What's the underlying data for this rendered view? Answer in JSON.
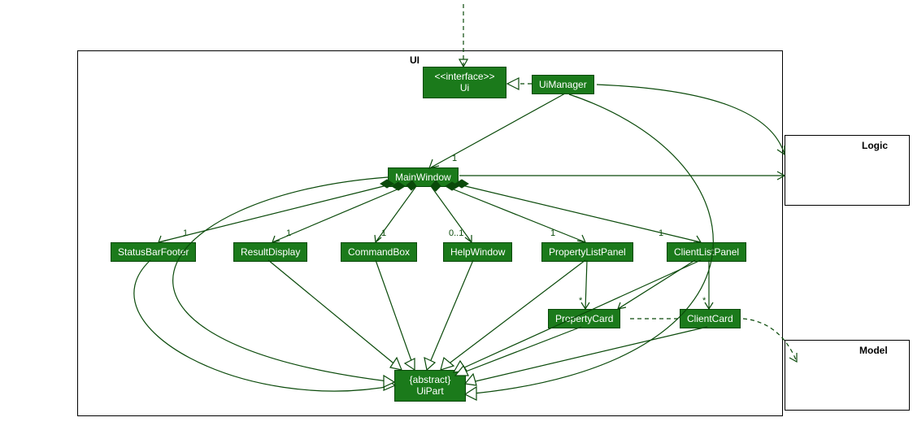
{
  "packages": {
    "ui": {
      "label": "UI"
    },
    "logic": {
      "label": "Logic"
    },
    "model": {
      "label": "Model"
    }
  },
  "classes": {
    "ui_interface": {
      "stereotype": "<<interface>>",
      "name": "Ui"
    },
    "uimanager": {
      "name": "UiManager"
    },
    "mainwindow": {
      "name": "MainWindow"
    },
    "statusbarfooter": {
      "name": "StatusBarFooter"
    },
    "resultdisplay": {
      "name": "ResultDisplay"
    },
    "commandbox": {
      "name": "CommandBox"
    },
    "helpwindow": {
      "name": "HelpWindow"
    },
    "propertylistpanel": {
      "name": "PropertyListPanel"
    },
    "clientlistpanel": {
      "name": "ClientListPanel"
    },
    "propertycard": {
      "name": "PropertyCard"
    },
    "clientcard": {
      "name": "ClientCard"
    },
    "uipart": {
      "stereotype": "{abstract}",
      "name": "UiPart"
    }
  },
  "multiplicities": {
    "mainwindow": "1",
    "statusbarfooter": "1",
    "resultdisplay": "1",
    "commandbox": "1",
    "helpwindow": "0..1",
    "propertylistpanel": "1",
    "clientlistpanel": "1",
    "propertycard": "*",
    "clientcard": "*"
  }
}
